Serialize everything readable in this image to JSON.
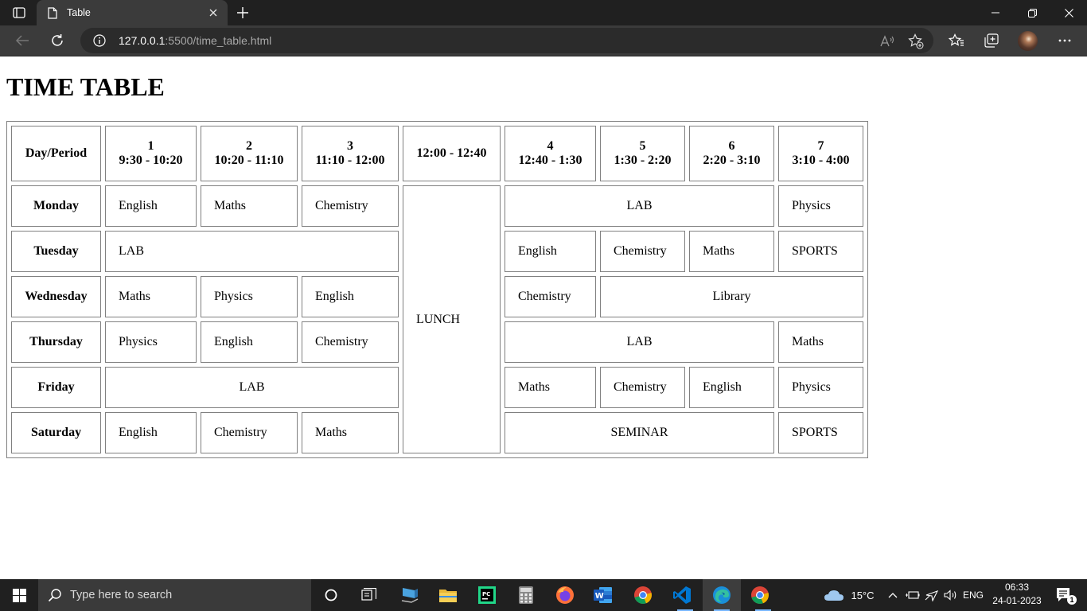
{
  "browser": {
    "tab_title": "Table",
    "url_host": "127.0.0.1",
    "url_path": ":5500/time_table.html"
  },
  "page": {
    "title": "TIME TABLE"
  },
  "timetable": {
    "header": {
      "corner": "Day/Period",
      "p1": {
        "num": "1",
        "time": "9:30 - 10:20"
      },
      "p2": {
        "num": "2",
        "time": "10:20 - 11:10"
      },
      "p3": {
        "num": "3",
        "time": "11:10 - 12:00"
      },
      "lunch_time": "12:00 - 12:40",
      "p4": {
        "num": "4",
        "time": "12:40 - 1:30"
      },
      "p5": {
        "num": "5",
        "time": "1:30 - 2:20"
      },
      "p6": {
        "num": "6",
        "time": "2:20 - 3:10"
      },
      "p7": {
        "num": "7",
        "time": "3:10 - 4:00"
      }
    },
    "lunch": "LUNCH",
    "monday": {
      "day": "Monday",
      "p1": "English",
      "p2": "Maths",
      "p3": "Chemistry",
      "p4_6": "LAB",
      "p7": "Physics"
    },
    "tuesday": {
      "day": "Tuesday",
      "p1_3": "LAB",
      "p4": "English",
      "p5": "Chemistry",
      "p6": "Maths",
      "p7": "SPORTS"
    },
    "wednesday": {
      "day": "Wednesday",
      "p1": "Maths",
      "p2": "Physics",
      "p3": "English",
      "p4": "Chemistry",
      "p5_7": "Library"
    },
    "thursday": {
      "day": "Thursday",
      "p1": "Physics",
      "p2": "English",
      "p3": "Chemistry",
      "p4_6": "LAB",
      "p7": "Maths"
    },
    "friday": {
      "day": "Friday",
      "p1_3": "LAB",
      "p4": "Maths",
      "p5": "Chemistry",
      "p6": "English",
      "p7": "Physics"
    },
    "saturday": {
      "day": "Saturday",
      "p1": "English",
      "p2": "Chemistry",
      "p3": "Maths",
      "p4_6": "SEMINAR",
      "p7": "SPORTS"
    }
  },
  "taskbar": {
    "search_placeholder": "Type here to search",
    "weather": "15°C",
    "language": "ENG",
    "time": "06:33",
    "date": "24-01-2023",
    "notification_count": "1"
  }
}
